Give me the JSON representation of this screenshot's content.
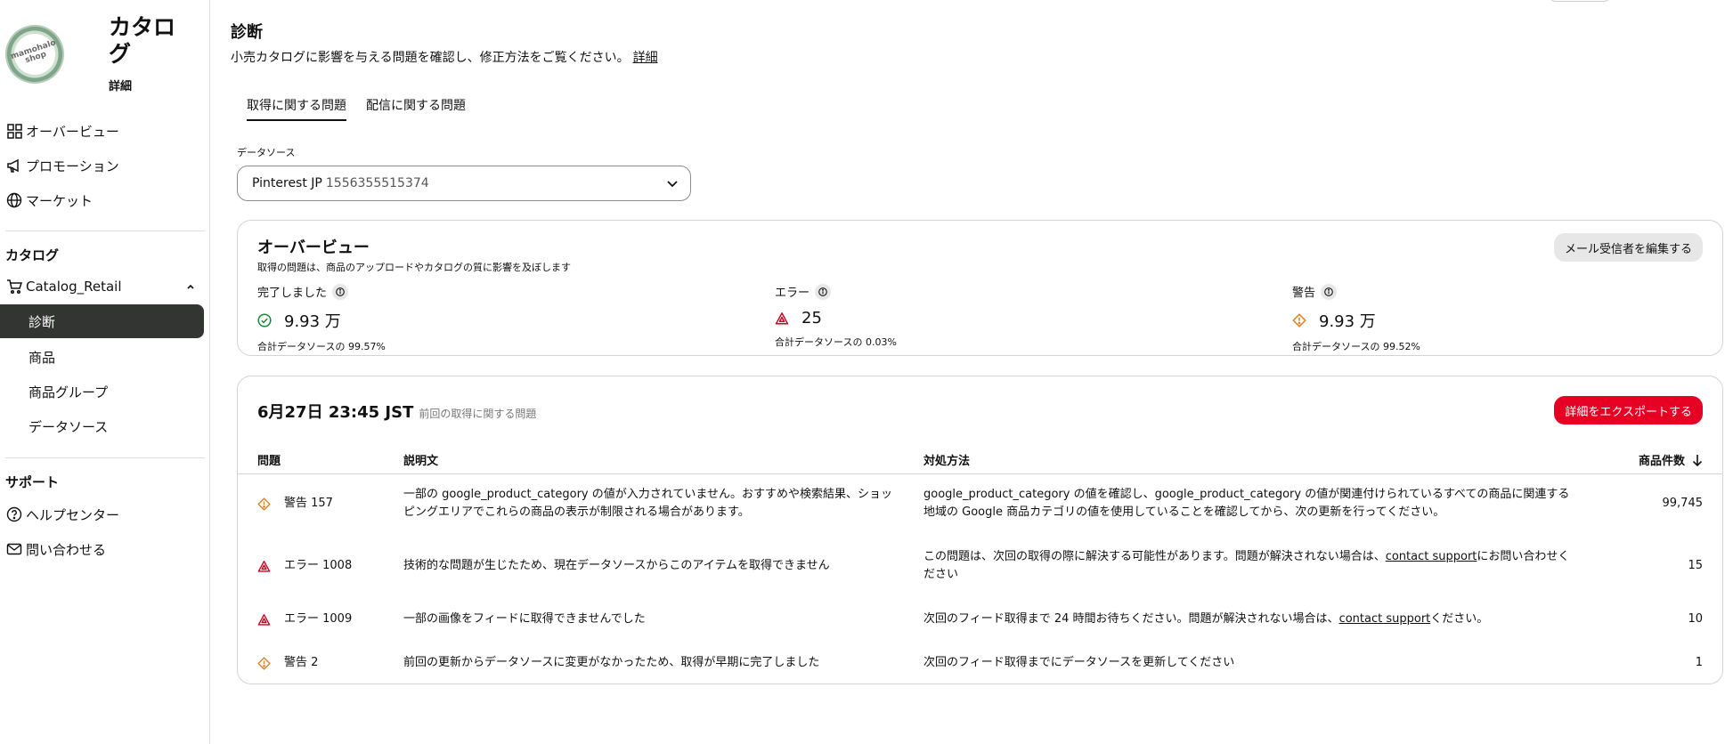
{
  "sidebar": {
    "logo_text": "mamohalo shop",
    "catalog_title": "カタログ",
    "catalog_sub": "詳細",
    "nav": [
      {
        "label": "オーバービュー",
        "icon": "grid-icon"
      },
      {
        "label": "プロモーション",
        "icon": "megaphone-icon"
      },
      {
        "label": "マーケット",
        "icon": "globe-icon"
      }
    ],
    "catalog_section": "カタログ",
    "catalog_name": "Catalog_Retail",
    "catalog_items": [
      "診断",
      "商品",
      "商品グループ",
      "データソース"
    ],
    "support_section": "サポート",
    "support_items": [
      {
        "label": "ヘルプセンター",
        "icon": "help-icon"
      },
      {
        "label": "問い合わせる",
        "icon": "mail-icon"
      }
    ]
  },
  "main": {
    "title": "診断",
    "desc": "小売カタログに影響を与える問題を確認し、修正方法をご覧ください。",
    "desc_link": "詳細",
    "tabs": [
      "取得に関する問題",
      "配信に関する問題"
    ],
    "datasource_label": "データソース",
    "datasource_name": "Pinterest JP",
    "datasource_id": "1556355515374"
  },
  "overview": {
    "title": "オーバービュー",
    "desc": "取得の問題は、商品のアップロードやカタログの質に影響を及ぼします",
    "edit_button": "メール受信者を編集する",
    "metrics": [
      {
        "label": "完了しました",
        "value": "9.93 万",
        "sub": "合計データソースの 99.57%",
        "icon": "check-circle-icon"
      },
      {
        "label": "エラー",
        "value": "25",
        "sub": "合計データソースの 0.03%",
        "icon": "error-triangle-icon"
      },
      {
        "label": "警告",
        "value": "9.93 万",
        "sub": "合計データソースの 99.52%",
        "icon": "warning-diamond-icon"
      }
    ]
  },
  "issues": {
    "date": "6月27日 23:45 JST",
    "date_hint": "前回の取得に関する問題",
    "export_button": "詳細をエクスポートする",
    "headers": {
      "issue": "問題",
      "desc": "説明文",
      "fix": "対処方法",
      "count": "商品件数"
    },
    "rows": [
      {
        "type": "warning",
        "issue": "警告 157",
        "desc": "一部の google_product_category の値が入力されていません。おすすめや検索結果、ショッピングエリアでこれらの商品の表示が制限される場合があります。",
        "fix": "google_product_category の値を確認し、google_product_category の値が関連付けられているすべての商品に関連する地域の Google 商品カテゴリの値を使用していることを確認してから、次の更新を行ってください。",
        "fix_link": "",
        "fix_after": "",
        "count": "99,745"
      },
      {
        "type": "error",
        "issue": "エラー 1008",
        "desc": "技術的な問題が生じたため、現在データソースからこのアイテムを取得できません",
        "fix": "この問題は、次回の取得の際に解決する可能性があります。問題が解決されない場合は、",
        "fix_link": "contact support",
        "fix_after": "にお問い合わせください",
        "count": "15"
      },
      {
        "type": "error",
        "issue": "エラー 1009",
        "desc": "一部の画像をフィードに取得できませんでした",
        "fix": "次回のフィード取得まで 24 時間お待ちください。問題が解決されない場合は、",
        "fix_link": "contact support",
        "fix_after": "ください。",
        "count": "10"
      },
      {
        "type": "warning",
        "issue": "警告 2",
        "desc": "前回の更新からデータソースに変更がなかったため、取得が早期に完了しました",
        "fix": "次回のフィード取得までにデータソースを更新してください",
        "fix_link": "",
        "fix_after": "",
        "count": "1"
      }
    ]
  },
  "colors": {
    "accent_red": "#e60023",
    "active_nav": "#333533",
    "success": "#1a8a3a",
    "warning": "#d9822b",
    "error": "#cc0022"
  }
}
